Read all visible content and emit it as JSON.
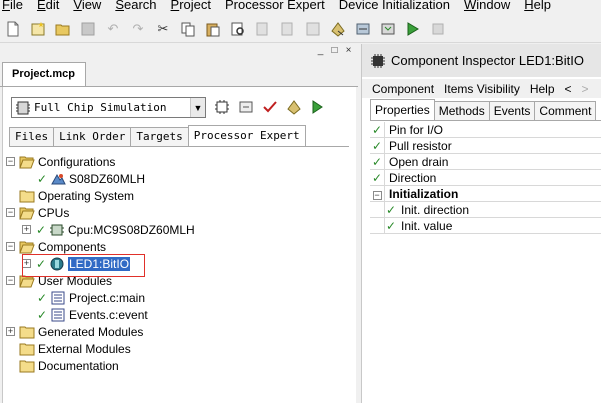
{
  "menu": [
    {
      "label": "File",
      "u": "F",
      "rest": "ile"
    },
    {
      "label": "Edit",
      "u": "E",
      "rest": "dit"
    },
    {
      "label": "View",
      "u": "V",
      "rest": "iew"
    },
    {
      "label": "Search",
      "u": "S",
      "rest": "earch"
    },
    {
      "label": "Project",
      "u": "P",
      "rest": "roject"
    },
    {
      "label": "Processor Expert",
      "u": "",
      "rest": "Processor Expert"
    },
    {
      "label": "Device Initialization",
      "u": "",
      "rest": "Device Initialization"
    },
    {
      "label": "Window",
      "u": "W",
      "rest": "indow"
    },
    {
      "label": "Help",
      "u": "H",
      "rest": "elp"
    }
  ],
  "left_panel": {
    "doc_tab": "Project.mcp",
    "target": "Full Chip Simulation",
    "tabs": [
      "Files",
      "Link Order",
      "Targets",
      "Processor Expert"
    ],
    "active_tab": "Processor Expert"
  },
  "tree": {
    "configurations": "Configurations",
    "config_item": "S08DZ60MLH",
    "operating_system": "Operating System",
    "cpus": "CPUs",
    "cpu_item": "Cpu:MC9S08DZ60MLH",
    "components": "Components",
    "component_item": "LED1:BitIO",
    "user_modules": "User Modules",
    "module_main": "Project.c:main",
    "module_event": "Events.c:event",
    "generated_modules": "Generated Modules",
    "external_modules": "External Modules",
    "documentation": "Documentation"
  },
  "inspector": {
    "title": "Component Inspector LED1:BitIO",
    "menu": [
      "Component",
      "Items Visibility",
      "Help"
    ],
    "nav_back": "<",
    "nav_fwd": ">",
    "tabs": [
      "Properties",
      "Methods",
      "Events",
      "Comment"
    ],
    "active_tab": "Properties",
    "properties": [
      {
        "label": "Pin for I/O",
        "kind": "item"
      },
      {
        "label": "Pull resistor",
        "kind": "item"
      },
      {
        "label": "Open drain",
        "kind": "item"
      },
      {
        "label": "Direction",
        "kind": "item"
      },
      {
        "label": "Initialization",
        "kind": "group"
      },
      {
        "label": "Init. direction",
        "kind": "sub"
      },
      {
        "label": "Init. value",
        "kind": "sub"
      }
    ]
  },
  "colors": {
    "selection": "#316ac5",
    "check": "#2a8a2a",
    "annotation_box": "#e0302a"
  }
}
